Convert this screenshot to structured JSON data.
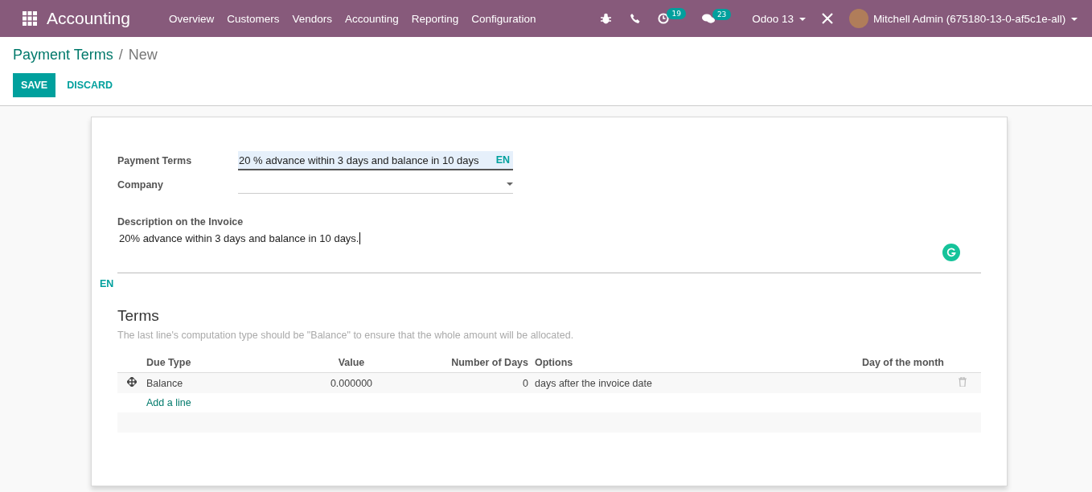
{
  "navbar": {
    "app_name": "Accounting",
    "menu": [
      "Overview",
      "Customers",
      "Vendors",
      "Accounting",
      "Reporting",
      "Configuration"
    ],
    "activity_count": "19",
    "message_count": "23",
    "database": "Odoo 13",
    "user": "Mitchell Admin (675180-13-0-af5c1e-all)"
  },
  "breadcrumb": {
    "items": [
      "Payment Terms",
      "New"
    ],
    "separator": "/"
  },
  "buttons": {
    "save": "SAVE",
    "discard": "DISCARD"
  },
  "form": {
    "fields": [
      {
        "label": "Payment Terms",
        "kind": "text",
        "value": "20 % advance within 3 days and balance in 10 days",
        "lang": "EN",
        "focused": true
      },
      {
        "label": "Company",
        "kind": "select",
        "focused": false
      }
    ],
    "description_label": "Description on the Invoice",
    "description": "20% advance within 3 days and balance in 10 days.",
    "description_lang": "EN",
    "terms_title": "Terms",
    "terms_hint": "The last line's computation type should be \"Balance\" to ensure that the whole amount will be allocated.",
    "table": {
      "columns": [
        "Due Type",
        "Value",
        "Number of Days",
        "Options",
        "Day of the month"
      ],
      "rows": [
        {
          "due_type": "Balance",
          "value": "0.000000",
          "days": "0",
          "options": "days after the invoice date"
        }
      ],
      "add_line": "Add a line"
    }
  }
}
